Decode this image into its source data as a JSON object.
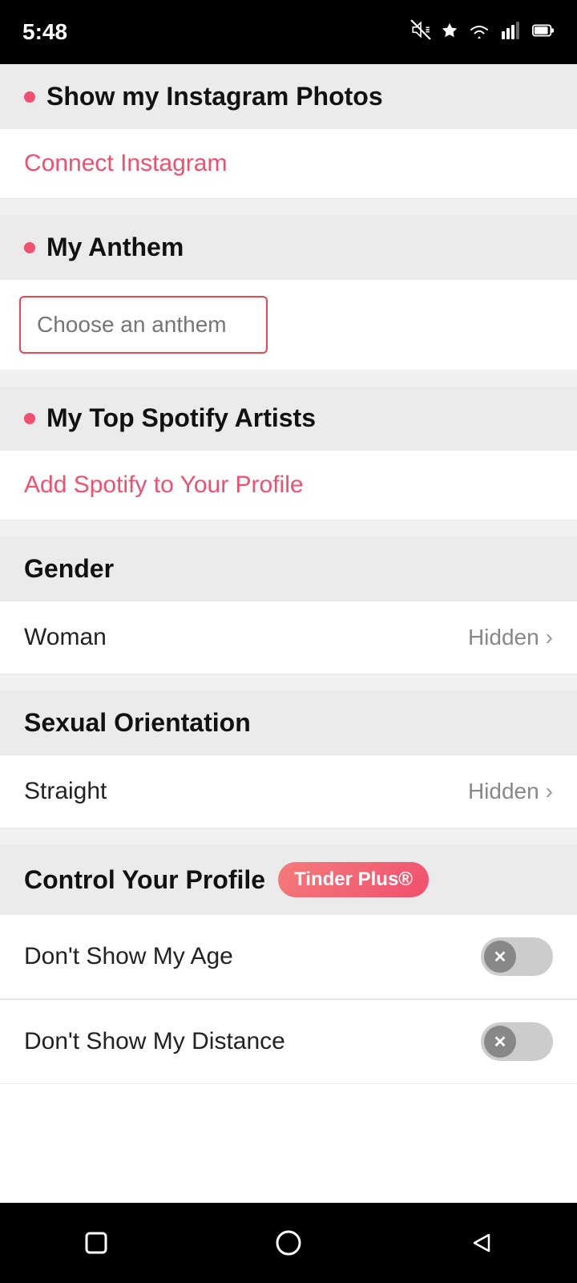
{
  "statusBar": {
    "time": "5:48",
    "icons": [
      "mute-icon",
      "assistant-icon",
      "wifi-icon",
      "signal-icon",
      "battery-icon"
    ]
  },
  "sections": {
    "instagram": {
      "title": "Show my Instagram Photos",
      "connectLabel": "Connect Instagram"
    },
    "anthem": {
      "title": "My Anthem",
      "placeholder": "Choose an anthem"
    },
    "spotify": {
      "title": "My Top Spotify Artists",
      "addLabel": "Add Spotify to Your Profile"
    },
    "gender": {
      "title": "Gender",
      "value": "Woman",
      "visibility": "Hidden"
    },
    "sexualOrientation": {
      "title": "Sexual Orientation",
      "value": "Straight",
      "visibility": "Hidden"
    },
    "controlProfile": {
      "title": "Control Your Profile",
      "badge": "Tinder Plus®",
      "options": [
        {
          "label": "Don't Show My Age",
          "toggled": false
        },
        {
          "label": "Don't Show My Distance",
          "toggled": false
        }
      ]
    }
  },
  "bottomNav": {
    "items": [
      "square-icon",
      "circle-icon",
      "back-icon"
    ]
  }
}
